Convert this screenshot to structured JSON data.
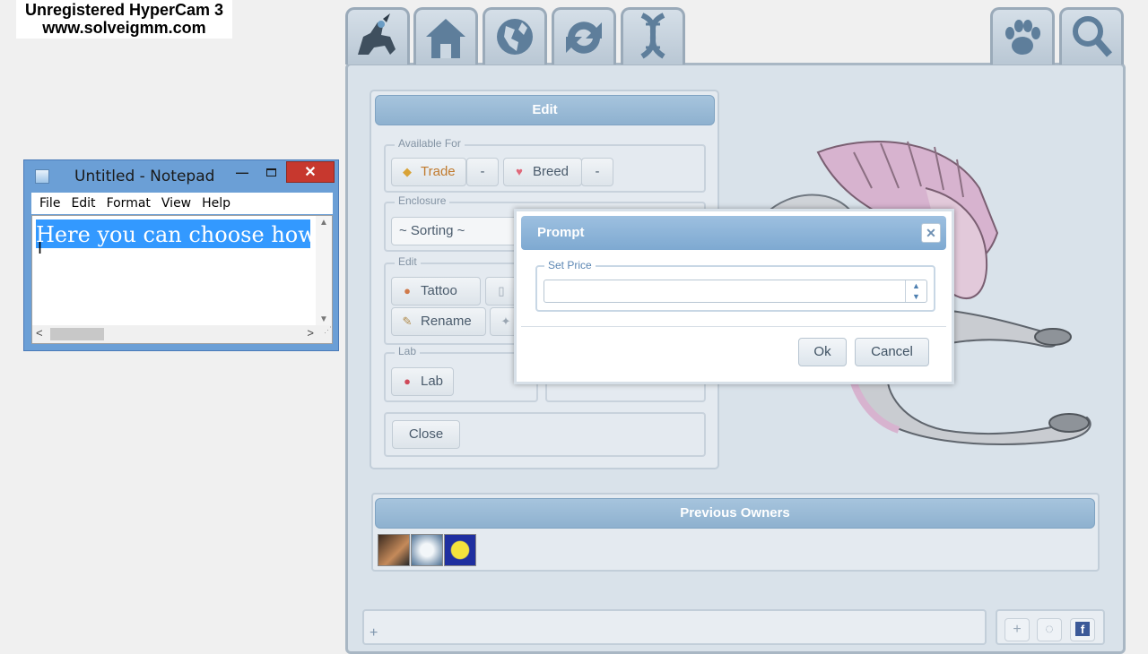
{
  "watermark": {
    "line1": "Unregistered HyperCam 3",
    "line2": "www.solveigmm.com"
  },
  "notepad": {
    "title": "Untitled - Notepad",
    "menu": [
      "File",
      "Edit",
      "Format",
      "View",
      "Help"
    ],
    "selected_text": "Here you can choose how"
  },
  "nav": {
    "tabs": [
      "pet-icon",
      "home-icon",
      "globe-icon",
      "refresh-icon",
      "dna-icon"
    ],
    "right_tabs": [
      "paw-icon",
      "search-icon"
    ]
  },
  "edit_panel": {
    "header": "Edit",
    "available_for": {
      "legend": "Available For",
      "trade": "Trade",
      "trade_dash": "-",
      "breed": "Breed",
      "breed_dash": "-"
    },
    "enclosure": {
      "legend": "Enclosure",
      "select": "~ Sorting ~"
    },
    "edit_group": {
      "legend": "Edit",
      "tattoo": "Tattoo",
      "rename": "Rename"
    },
    "lab_group": {
      "legend": "Lab",
      "lab": "Lab"
    },
    "close": "Close"
  },
  "owners": {
    "header": "Previous Owners"
  },
  "bottom": {
    "add": "+",
    "mini_plus": "+"
  },
  "prompt": {
    "title": "Prompt",
    "legend": "Set Price",
    "value": "",
    "ok": "Ok",
    "cancel": "Cancel"
  }
}
